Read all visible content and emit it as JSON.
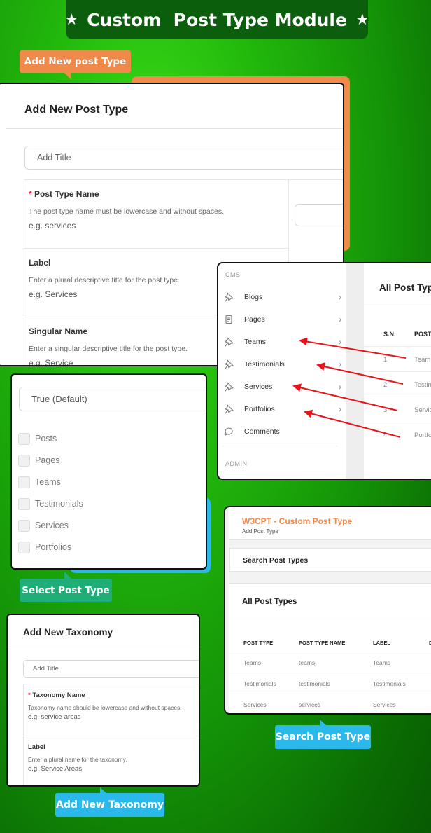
{
  "header": {
    "title": "Custom  Post Type Module",
    "star": "★"
  },
  "tags": {
    "add_new_post_type": "Add New post Type",
    "select_post_type": "Select Post Type",
    "add_new_taxonomy": "Add New Taxonomy",
    "search_post_type": "Search Post Type"
  },
  "colors": {
    "orange": "#f08a4b",
    "blue": "#2bb8ea",
    "teal": "#1fae77",
    "dark_green": "#0b5e0b",
    "arrow": "#e8141a",
    "brand": "#f08a4b"
  },
  "post_type_form": {
    "heading": "Add New Post Type",
    "title_placeholder": "Add Title",
    "fields": [
      {
        "required": "*",
        "label": "Post Type Name",
        "help": "The post type name must be lowercase and without spaces.",
        "example": "e.g. services"
      },
      {
        "required": "",
        "label": "Label",
        "help": "Enter a plural descriptive title for the post type.",
        "example": "e.g. Services"
      },
      {
        "required": "",
        "label": "Singular Name",
        "help": "Enter a singular descriptive title for the post type.",
        "example": "e.g. Service"
      }
    ]
  },
  "cms_menu": {
    "section": "CMS",
    "items": [
      {
        "label": "Blogs",
        "icon": "pin-icon"
      },
      {
        "label": "Pages",
        "icon": "pages-icon"
      },
      {
        "label": "Teams",
        "icon": "pin-icon"
      },
      {
        "label": "Testimonials",
        "icon": "pin-icon"
      },
      {
        "label": "Services",
        "icon": "pin-icon"
      },
      {
        "label": "Portfolios",
        "icon": "pin-icon"
      },
      {
        "label": "Comments",
        "icon": "comment-icon"
      }
    ],
    "admin_section": "ADMIN",
    "list_title": "All Post Typ",
    "columns": [
      "S.N.",
      "POST"
    ],
    "rows": [
      {
        "sn": "1",
        "post": "Team"
      },
      {
        "sn": "2",
        "post": "Testin"
      },
      {
        "sn": "3",
        "post": "Servic"
      },
      {
        "sn": "4",
        "post": "Portfo"
      }
    ]
  },
  "select_panel": {
    "dropdown_value": "True (Default)",
    "options": [
      "Posts",
      "Pages",
      "Teams",
      "Testimonials",
      "Services",
      "Portfolios"
    ]
  },
  "search_panel": {
    "brand": "W3CPT - Custom Post Type",
    "breadcrumb": "Add Post Type",
    "search_label": "Search Post Types",
    "list_title": "All Post Types",
    "columns": [
      "POST TYPE",
      "POST TYPE NAME",
      "LABEL",
      "D"
    ],
    "rows": [
      [
        "Teams",
        "teams",
        "Teams"
      ],
      [
        "Testimonials",
        "testimonials",
        "Testimonials"
      ],
      [
        "Services",
        "services",
        "Services"
      ]
    ]
  },
  "taxonomy_form": {
    "heading": "Add New Taxonomy",
    "title_placeholder": "Add Title",
    "fields": [
      {
        "required": "*",
        "label": "Taxonomy Name",
        "help": "Taxonomy name should be lowercase and without spaces.",
        "example": "e.g. service-areas"
      },
      {
        "required": "",
        "label": "Label",
        "help": "Enter a plural name for the taxonomy.",
        "example": "e.g. Service Areas"
      }
    ]
  }
}
